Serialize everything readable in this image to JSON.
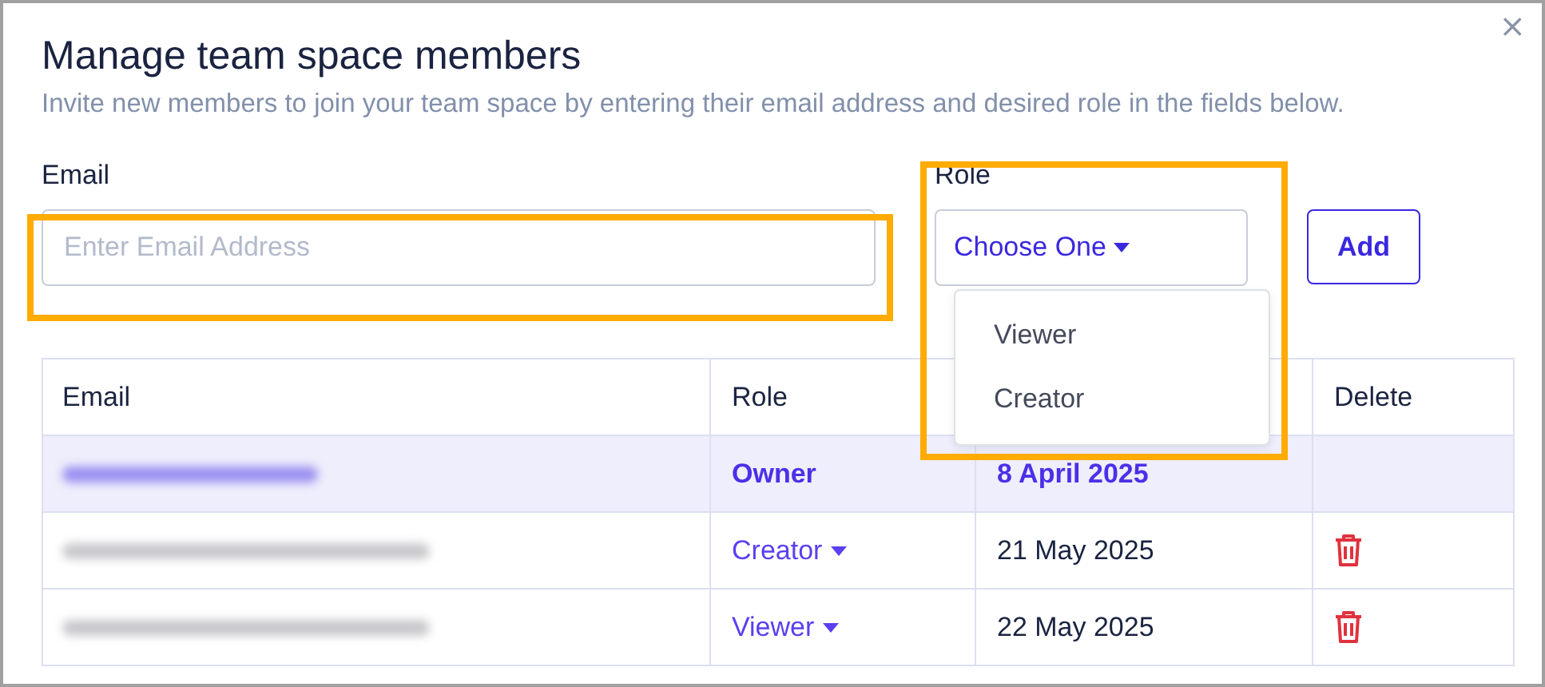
{
  "dialog": {
    "title": "Manage team space members",
    "subtitle": "Invite new members to join your team space by entering their email address and desired role in the fields below.",
    "close": "×"
  },
  "form": {
    "email_label": "Email",
    "email_placeholder": "Enter Email Address",
    "role_label": "Role",
    "role_value": "Choose One",
    "role_menu_open": true,
    "role_options": [
      "Viewer",
      "Creator"
    ],
    "add_button": "Add"
  },
  "table": {
    "columns": [
      "Email",
      "Role",
      "",
      "Delete"
    ],
    "rows": [
      {
        "current": true,
        "role": "Owner",
        "role_editable": false,
        "date": "8 April 2025",
        "deletable": false
      },
      {
        "current": false,
        "role": "Creator",
        "role_editable": true,
        "date": "21 May 2025",
        "deletable": true
      },
      {
        "current": false,
        "role": "Viewer",
        "role_editable": true,
        "date": "22 May 2025",
        "deletable": true
      }
    ]
  }
}
